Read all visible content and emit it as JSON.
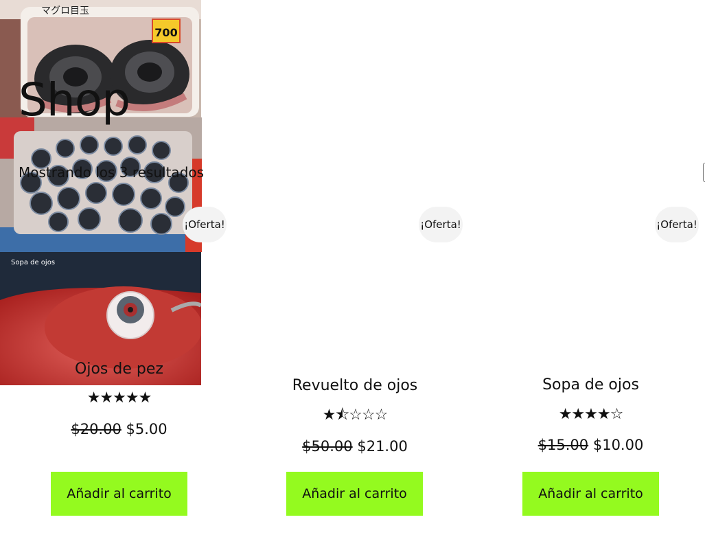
{
  "page": {
    "title": "Shop",
    "result_count": "Mostrando los 3 resultados"
  },
  "colors": {
    "button_bg": "#94fa1f",
    "badge_bg": "#f3f3f3"
  },
  "products": [
    {
      "name": "Ojos de pez",
      "badge": "¡Oferta!",
      "rating": 5,
      "stars": "★★★★★",
      "price_old": "$20.00",
      "price_new": "$5.00",
      "button": "Añadir al carrito",
      "image_label": "マグロ目玉",
      "image_price_tag": "700"
    },
    {
      "name": "Revuelto de ojos",
      "badge": "¡Oferta!",
      "rating": 1.5,
      "stars": "★⯪☆☆☆",
      "price_old": "$50.00",
      "price_new": "$21.00",
      "button": "Añadir al carrito"
    },
    {
      "name": "Sopa de ojos",
      "badge": "¡Oferta!",
      "rating": 4,
      "stars": "★★★★☆",
      "price_old": "$15.00",
      "price_new": "$10.00",
      "button": "Añadir al carrito",
      "image_caption": "Sopa de ojos"
    }
  ]
}
